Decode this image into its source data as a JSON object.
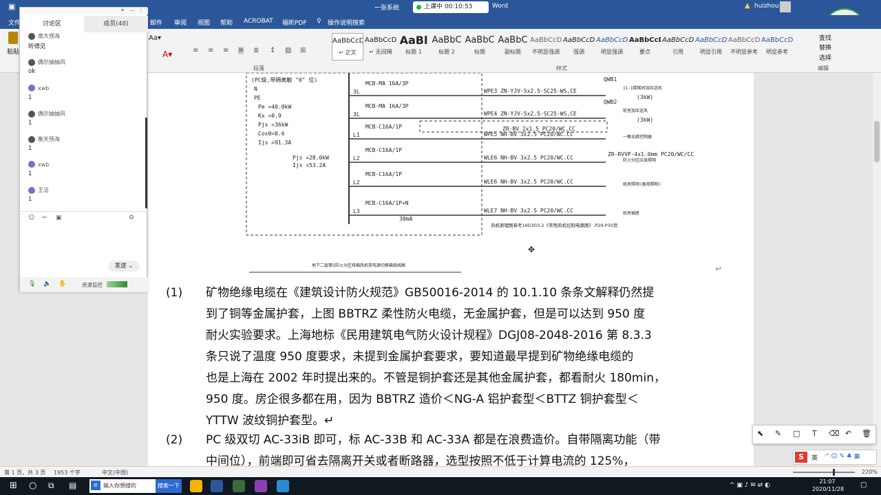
{
  "window": {
    "title": "一张系统",
    "app": "Word",
    "user": "huizhou",
    "recording": "上课中 00:10:53"
  },
  "ribbon_tabs": [
    "文件",
    "邮件",
    "审阅",
    "视图",
    "帮助",
    "ACROBAT",
    "福昕PDF",
    "操作说明搜索"
  ],
  "ribbon": {
    "paste_label": "粘贴",
    "group_paragraph": "段落",
    "group_styles": "样式",
    "group_editing": "编辑",
    "styles": [
      {
        "preview": "AaBbCcDi",
        "name": "↵ 正文"
      },
      {
        "preview": "AaBbCcDi",
        "name": "↵ 无间隔"
      },
      {
        "preview": "AaBl",
        "name": "标题 1"
      },
      {
        "preview": "AaBbC",
        "name": "标题 2"
      },
      {
        "preview": "AaBbC",
        "name": "标题"
      },
      {
        "preview": "AaBbC",
        "name": "副标题"
      },
      {
        "preview": "AaBbCcD",
        "name": "不明显强调"
      },
      {
        "preview": "AaBbCcD",
        "name": "强调"
      },
      {
        "preview": "AaBbCcD",
        "name": "明显强调"
      },
      {
        "preview": "AaBbCcD",
        "name": "要点"
      },
      {
        "preview": "AaBbCcD",
        "name": "引用"
      },
      {
        "preview": "AaBbCcD",
        "name": "明显引用"
      },
      {
        "preview": "AaBbCcDc",
        "name": "不明显参考"
      },
      {
        "preview": "AaBbCcDc",
        "name": "明显参考"
      }
    ],
    "editing": [
      "查找",
      "替换",
      "选择"
    ]
  },
  "chat": {
    "tab_discussion": "讨论区",
    "tab_members": "成员(48)",
    "messages": [
      {
        "user": "南大预海",
        "text": "听得见",
        "avatar": "#555555"
      },
      {
        "user": "偶尔抽抽风",
        "text": "ok",
        "avatar": "#555555"
      },
      {
        "user": "xwb",
        "text": "1",
        "avatar": "#7a6fd0"
      },
      {
        "user": "偶尔抽抽风",
        "text": "1",
        "avatar": "#555555"
      },
      {
        "user": "衡天预海",
        "text": "1",
        "avatar": "#555555"
      },
      {
        "user": "xwb",
        "text": "1",
        "avatar": "#7a6fd0"
      },
      {
        "user": "王洁",
        "text": "1",
        "avatar": "#7a6fd0"
      }
    ],
    "send_label": "发送",
    "resource_label": "资源监控"
  },
  "diagram": {
    "left_box": [
      "(PC级,带隔离触 \"0\" 位)",
      "N",
      "PE",
      "Pe =40.0kW",
      "Kx =0.9",
      "Pjs =36kW",
      "Cosθ=0.6",
      "Ijs =91.3A"
    ],
    "mid_values": [
      "Pjs =28.0kW",
      "Ijs =53.2A"
    ],
    "rows": [
      {
        "phase": "3L",
        "breaker": "MCB-MA 16A/3P",
        "cable": "WPE3 ZN-YJV-5x2.5-SC25-WS,CE",
        "load": "QWB1",
        "desc": "11-1楼梯间加压送风",
        "power": "(3kW)"
      },
      {
        "phase": "3L",
        "breaker": "MCB-MA 16A/3P",
        "cable": "WPE4 ZN-YJV-5x2.5-SC25-WS,CE",
        "load": "QWB2",
        "desc": "前室加压送风",
        "power": "(3kW)"
      },
      {
        "phase": "L1",
        "breaker": "MCB-C16A/1P",
        "cable": "WPE5 NH-BV 3x2.5 PC20/WC.CC",
        "load": "",
        "desc": "一氧化碳控制器",
        "power": ""
      },
      {
        "phase": "L2",
        "breaker": "MCB-C16A/1P",
        "cable": "WLE6 NH-BV 3x2.5 PC20/WC.CC",
        "load": "",
        "desc": "防火分区应急照明",
        "power": ""
      },
      {
        "phase": "L2",
        "breaker": "MCB-C16A/1P",
        "cable": "WLE6 NH-BV 3x2.5 PC20/WC.CC",
        "load": "",
        "desc": "机房照明(备用照明)",
        "power": ""
      },
      {
        "phase": "L3",
        "breaker": "MCB-C16A/1P+N",
        "cable": "WLE7 NH-BV 3x2.5 PC20/WC.CC",
        "load": "",
        "desc": "机房插座",
        "power": ""
      }
    ],
    "extra_cable_1": "ZR-BV 2x1.5 PC20/WC.CC",
    "extra_cable_2": "ZR-RVVP-4x1.0mm PC20/WC/CC",
    "rcd": "30mA",
    "note": "风机原理图参考16D303-2《常用风机控制电路图》,P29-P30页",
    "caption": "地下二层第5防火分区排烟风机双电源切换箱接线图"
  },
  "paragraphs": [
    {
      "num": "(1)",
      "lines": [
        "矿物绝缘电缆在《建筑设计防火规范》GB50016-2014 的 10.1.10 条条文解释仍然提",
        "到了铜等金属护套，上图 BBTRZ 柔性防火电缆，无金属护套，但是可以达到 950 度",
        "耐火实验要求。上海地标《民用建筑电气防火设计规程》DGJ08-2048-2016 第 8.3.3",
        "条只说了温度 950 度要求，未提到金属护套要求，要知道最早提到矿物绝缘电缆的",
        "也是上海在 2002 年时提出来的。不管是铜护套还是其他金属护套，都看耐火 180min，",
        "950 度。房企很多都在用，因为 BBTRZ 造价＜NG-A 铝护套型＜BTTZ 铜护套型＜",
        "YTTW 波纹铜护套型。↵"
      ]
    },
    {
      "num": "(2)",
      "lines": [
        "PC 级双切 AC-33iB 即可，标 AC-33B 和 AC-33A 都是在浪费造价。自带隔离功能（带",
        "中间位），前端即可省去隔离开关或者断路器，选型按照不低于计算电流的 125%，"
      ]
    }
  ],
  "status": {
    "page": "第 1 页，共 3 页",
    "words": "1953 个字",
    "lang": "中文(中国)",
    "zoom": "220%"
  },
  "taskbar": {
    "search_placeholder": "输入你想搜的",
    "search_button": "搜索一下",
    "time": "21:07",
    "date": "2020/11/28",
    "ime": "英"
  }
}
